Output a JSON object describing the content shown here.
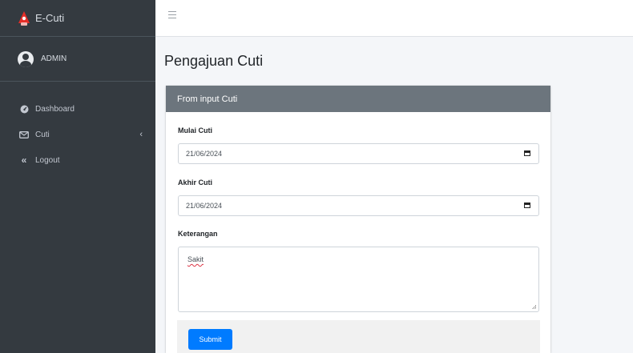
{
  "brand": {
    "name": "E-Cuti"
  },
  "user": {
    "name": "ADMIN"
  },
  "sidebar": {
    "items": [
      {
        "label": "Dashboard",
        "icon": "tachometer-icon"
      },
      {
        "label": "Cuti",
        "icon": "envelope-icon",
        "has_submenu": true
      },
      {
        "label": "Logout",
        "icon": "double-chevron-left-icon"
      }
    ]
  },
  "page": {
    "title": "Pengajuan Cuti"
  },
  "form": {
    "header": "From input Cuti",
    "start": {
      "label": "Mulai Cuti",
      "value": "21/06/2024"
    },
    "end": {
      "label": "Akhir Cuti",
      "value": "21/06/2024"
    },
    "note": {
      "label": "Keterangan",
      "value": "Sakit"
    },
    "submit_label": "Submit"
  },
  "colors": {
    "sidebar_bg": "#343a40",
    "card_header_bg": "#6c757d",
    "primary": "#007bff",
    "brand_logo": "#e52d27"
  }
}
